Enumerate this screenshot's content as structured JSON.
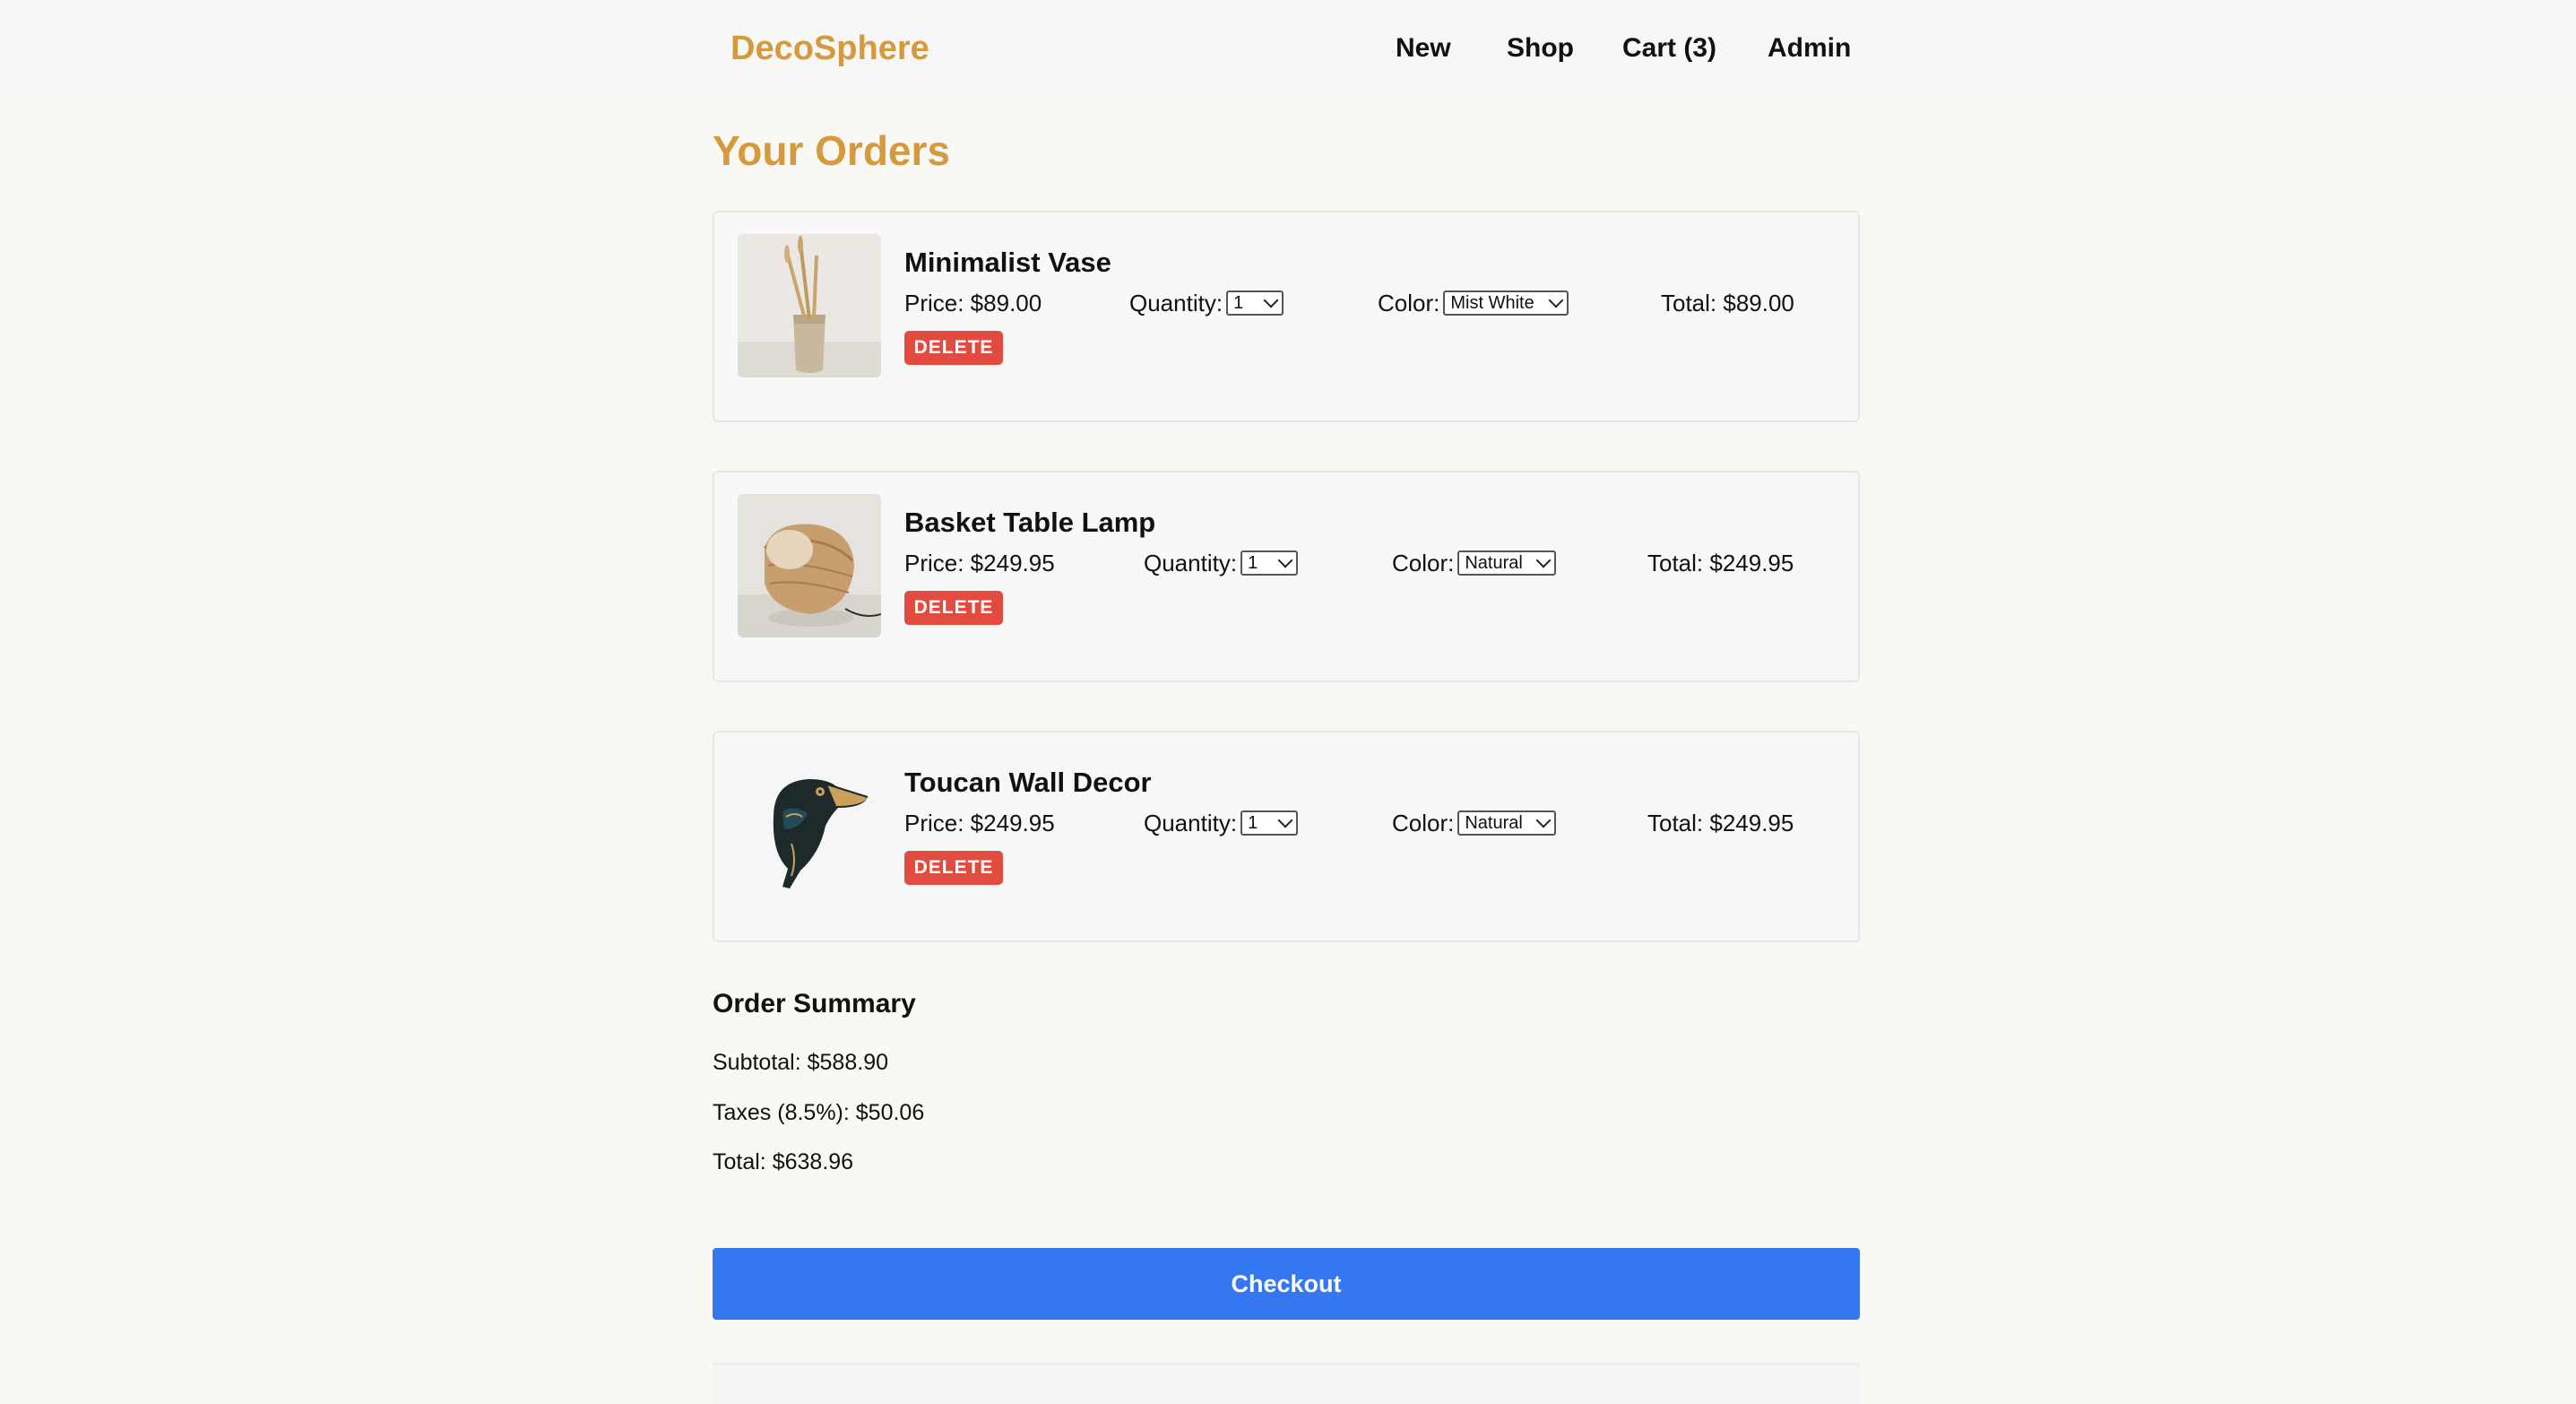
{
  "brand": "DecoSphere",
  "nav": {
    "new": "New",
    "shop": "Shop",
    "cart": "Cart (3)",
    "admin": "Admin"
  },
  "page_title": "Your Orders",
  "orders": [
    {
      "name": "Minimalist Vase",
      "price": "Price: $89.00",
      "quantity_label": "Quantity:",
      "quantity_value": "1",
      "color_label": "Color:",
      "color_value": "Mist White",
      "total": "Total: $89.00",
      "delete_label": "DELETE",
      "image_icon": "vase-image"
    },
    {
      "name": "Basket Table Lamp",
      "price": "Price: $249.95",
      "quantity_label": "Quantity:",
      "quantity_value": "1",
      "color_label": "Color:",
      "color_value": "Natural",
      "total": "Total: $249.95",
      "delete_label": "DELETE",
      "image_icon": "lamp-image"
    },
    {
      "name": "Toucan Wall Decor",
      "price": "Price: $249.95",
      "quantity_label": "Quantity:",
      "quantity_value": "1",
      "color_label": "Color:",
      "color_value": "Natural",
      "total": "Total: $249.95",
      "delete_label": "DELETE",
      "image_icon": "toucan-image"
    }
  ],
  "summary": {
    "title": "Order Summary",
    "subtotal": "Subtotal: $588.90",
    "taxes": "Taxes (8.5%): $50.06",
    "total": "Total: $638.96"
  },
  "checkout_label": "Checkout",
  "colors": {
    "brand": "#d69a3e",
    "delete": "#e24b3f",
    "checkout": "#3577f0",
    "background": "#f9f8f5"
  }
}
